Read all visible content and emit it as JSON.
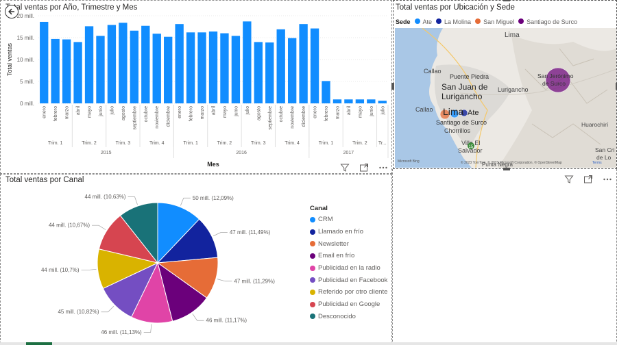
{
  "back_icon": "back-arrow-icon",
  "bar_chart": {
    "title": "Total ventas por Año, Trimestre y Mes",
    "chart_data": {
      "type": "bar",
      "title": "Total ventas por Año, Trimestre y Mes",
      "xlabel": "Mes",
      "ylabel": "Total ventas",
      "ylim": [
        0,
        20
      ],
      "yticks": [
        "0 mill.",
        "5 mill.",
        "10 mill.",
        "15 mill.",
        "20 mill."
      ],
      "color": "#118DFF",
      "categories": [
        "enero",
        "febrero",
        "marzo",
        "abril",
        "mayo",
        "junio",
        "julio",
        "agosto",
        "septiembre",
        "octubre",
        "noviembre",
        "diciembre",
        "enero",
        "febrero",
        "marzo",
        "abril",
        "mayo",
        "junio",
        "julio",
        "agosto",
        "septiembre",
        "octubre",
        "noviembre",
        "diciembre",
        "enero",
        "febrero",
        "marzo",
        "abril",
        "mayo",
        "junio",
        "julio"
      ],
      "values": [
        18.6,
        14.7,
        14.6,
        14.0,
        17.6,
        15.4,
        17.9,
        18.4,
        16.6,
        17.7,
        15.9,
        15.2,
        18.1,
        16.2,
        16.2,
        16.4,
        16.0,
        15.4,
        18.7,
        14.0,
        13.9,
        16.9,
        14.9,
        18.1,
        17.1,
        5.1,
        0.9,
        0.9,
        0.9,
        0.9,
        0.6
      ],
      "quarters": [
        {
          "label": "Trim. 1",
          "start": 0,
          "end": 2
        },
        {
          "label": "Trim. 2",
          "start": 3,
          "end": 5
        },
        {
          "label": "Trim. 3",
          "start": 6,
          "end": 8
        },
        {
          "label": "Trim. 4",
          "start": 9,
          "end": 11
        },
        {
          "label": "Trim. 1",
          "start": 12,
          "end": 14
        },
        {
          "label": "Trim. 2",
          "start": 15,
          "end": 17
        },
        {
          "label": "Trim. 3",
          "start": 18,
          "end": 20
        },
        {
          "label": "Trim. 4",
          "start": 21,
          "end": 23
        },
        {
          "label": "Trim. 1",
          "start": 24,
          "end": 26
        },
        {
          "label": "Trim. 2",
          "start": 27,
          "end": 29
        },
        {
          "label": "Tr...",
          "start": 30,
          "end": 30
        }
      ],
      "years": [
        {
          "label": "2015",
          "start": 0,
          "end": 11
        },
        {
          "label": "2016",
          "start": 12,
          "end": 23
        },
        {
          "label": "2017",
          "start": 24,
          "end": 30
        }
      ]
    }
  },
  "map": {
    "title": "Total ventas por Ubicación y Sede",
    "legend_title": "Sede",
    "legend": [
      {
        "label": "Ate",
        "color": "#118DFF"
      },
      {
        "label": "La Molina",
        "color": "#12239E"
      },
      {
        "label": "San Miguel",
        "color": "#E66C37"
      },
      {
        "label": "Santiago de Surco",
        "color": "#6B007B"
      }
    ],
    "places": {
      "lima_top": "Lima",
      "callao1": "Callao",
      "puente_piedra": "Puente Piedra",
      "san_juan": "San Juan de",
      "lurigancho": "Lurigancho",
      "lurigancho2": "Lurigancho",
      "san_jeronimo": "San Jerónimo",
      "de_surco": "de Surco",
      "callao2": "Callao",
      "lima": "Lima",
      "ate": "Ate",
      "santiago": "Santiago de Surco",
      "chorrillos": "Chorrillos",
      "villa_el": "Villa El",
      "salvador": "Salvador",
      "punta_negra": "Punta Negra",
      "huarochiri": "Huarochirí",
      "san_cr": "San Cri",
      "de_lo": "de Lo"
    },
    "attribution": "© 2023 TomTom, © 2023 Microsoft Corporation, © OpenStreetMap",
    "terms": "Terms",
    "bing": "Microsoft Bing",
    "route": "15"
  },
  "pie": {
    "title": "Total ventas por Canal",
    "chart_data": {
      "type": "pie",
      "title": "Total ventas por Canal",
      "legend_title": "Canal",
      "slices": [
        {
          "name": "CRM",
          "label": "50 mill. (12,09%)",
          "percent": 12.09,
          "color": "#118DFF"
        },
        {
          "name": "Llamado en frío",
          "label": "47 mill. (11,49%)",
          "percent": 11.49,
          "color": "#12239E"
        },
        {
          "name": "Newsletter",
          "label": "47 mill. (11,29%)",
          "percent": 11.29,
          "color": "#E66C37"
        },
        {
          "name": "Email en frío",
          "label": "46 mill. (11,17%)",
          "percent": 11.17,
          "color": "#6B007B"
        },
        {
          "name": "Publicidad en la radio",
          "label": "46 mill. (11,13%)",
          "percent": 11.13,
          "color": "#E044A7"
        },
        {
          "name": "Publicidad en Facebook",
          "label": "45 mill. (10,82%)",
          "percent": 10.82,
          "color": "#744EC2"
        },
        {
          "name": "Referido por otro cliente",
          "label": "44 mill. (10,7%)",
          "percent": 10.7,
          "color": "#D9B300"
        },
        {
          "name": "Publicidad en Google",
          "label": "44 mill. (10,67%)",
          "percent": 10.67,
          "color": "#D64550"
        },
        {
          "name": "Desconocido",
          "label": "44 mill. (10,63%)",
          "percent": 10.63,
          "color": "#197278"
        }
      ]
    }
  }
}
